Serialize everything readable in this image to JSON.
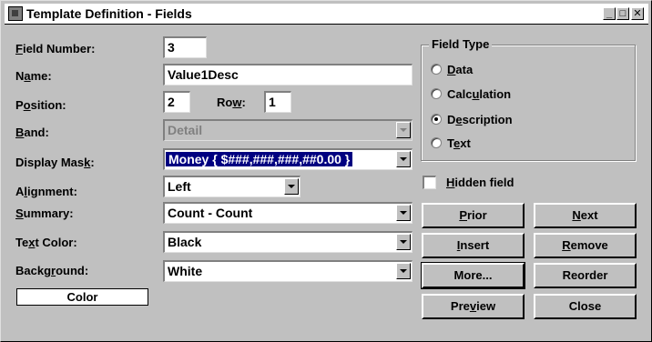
{
  "window": {
    "title": "Template Definition - Fields",
    "controls": {
      "minimize": "_",
      "maximize": "□",
      "close": "✕"
    }
  },
  "labels": {
    "field_number": {
      "pre": "",
      "ul": "F",
      "post": "ield Number:"
    },
    "name": {
      "pre": "N",
      "ul": "a",
      "post": "me:"
    },
    "position": {
      "pre": "P",
      "ul": "o",
      "post": "sition:"
    },
    "row": {
      "pre": "Ro",
      "ul": "w",
      "post": ":"
    },
    "band": {
      "pre": "",
      "ul": "B",
      "post": "and:"
    },
    "display_mask": {
      "pre": "Display Mas",
      "ul": "k",
      "post": ":"
    },
    "alignment": {
      "pre": "A",
      "ul": "l",
      "post": "ignment:"
    },
    "summary": {
      "pre": "",
      "ul": "S",
      "post": "ummary:"
    },
    "text_color": {
      "pre": "Te",
      "ul": "x",
      "post": "t Color:"
    },
    "background": {
      "pre": "Backg",
      "ul": "r",
      "post": "ound:"
    }
  },
  "fields": {
    "field_number": "3",
    "name": "Value1Desc",
    "position": "2",
    "row": "1",
    "band": "Detail",
    "display_mask": "Money { $###,###,###,##0.00 }",
    "alignment": "Left",
    "summary": "Count - Count",
    "text_color": "Black",
    "background": "White"
  },
  "field_type": {
    "legend": "Field Type",
    "options": [
      {
        "pre": "",
        "ul": "D",
        "post": "ata",
        "selected": false
      },
      {
        "pre": "Calc",
        "ul": "u",
        "post": "lation",
        "selected": false
      },
      {
        "pre": "D",
        "ul": "e",
        "post": "scription",
        "selected": true
      },
      {
        "pre": "T",
        "ul": "e",
        "post": "xt",
        "selected": false
      }
    ]
  },
  "hidden_field": {
    "pre": "",
    "ul": "H",
    "post": "idden field",
    "checked": false
  },
  "buttons": {
    "prior": {
      "pre": "",
      "ul": "P",
      "post": "rior"
    },
    "next": {
      "pre": "",
      "ul": "N",
      "post": "ext"
    },
    "insert": {
      "pre": "",
      "ul": "I",
      "post": "nsert"
    },
    "remove": {
      "pre": "",
      "ul": "R",
      "post": "emove"
    },
    "more": {
      "label": "More..."
    },
    "reorder": {
      "label": "Reorder"
    },
    "preview": {
      "pre": "Pre",
      "ul": "v",
      "post": "iew"
    },
    "close": {
      "label": "Close"
    }
  },
  "color_box": "Color"
}
